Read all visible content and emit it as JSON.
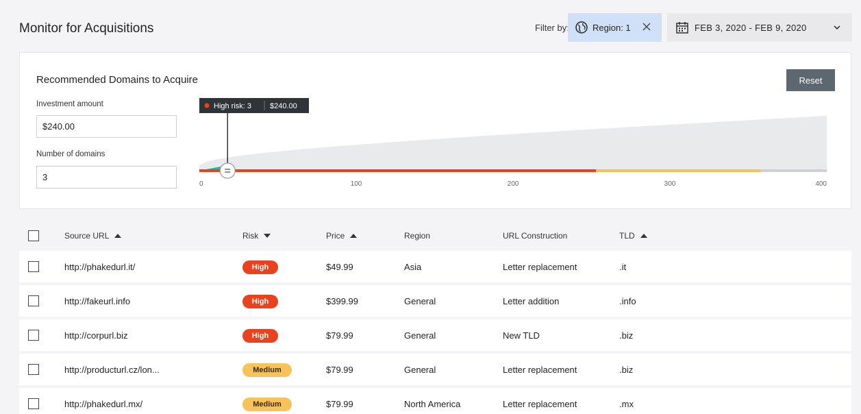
{
  "header": {
    "title": "Monitor for Acquisitions",
    "filter_label": "Filter by:",
    "region_chip": "Region: 1",
    "date_range": "FEB 3, 2020 - FEB 9, 2020"
  },
  "panel": {
    "title": "Recommended Domains to Acquire",
    "reset_label": "Reset",
    "investment_label": "Investment amount",
    "investment_value": "$240.00",
    "domains_label": "Number of domains",
    "domains_value": "3"
  },
  "chart_data": {
    "type": "area",
    "x_ticks": [
      "0",
      "100",
      "200",
      "300",
      "400"
    ],
    "xlim": [
      0,
      400
    ],
    "tooltip": {
      "label": "High risk: 3",
      "value": "$240.00"
    },
    "slider_value": 18,
    "risk_segments": [
      {
        "risk": "High",
        "from": 0,
        "to": 253,
        "color": "#e8421f"
      },
      {
        "risk": "Medium",
        "from": 253,
        "to": 358,
        "color": "#f7c25a"
      },
      {
        "risk": "Low",
        "from": 358,
        "to": 400,
        "color": "#d0d0d4"
      }
    ],
    "area_color": "#e9eaec",
    "selected_color": "#2fb3a0"
  },
  "table": {
    "columns": [
      {
        "label": "Source URL",
        "sort": "asc"
      },
      {
        "label": "Risk",
        "sort": "desc"
      },
      {
        "label": "Price",
        "sort": "asc"
      },
      {
        "label": "Region",
        "sort": ""
      },
      {
        "label": "URL Construction",
        "sort": ""
      },
      {
        "label": "TLD",
        "sort": "asc"
      }
    ],
    "rows": [
      {
        "url": "http://phakedurl.it/",
        "risk": "High",
        "price": "$49.99",
        "region": "Asia",
        "construction": "Letter replacement",
        "tld": ".it"
      },
      {
        "url": "http://fakeurl.info",
        "risk": "High",
        "price": "$399.99",
        "region": "General",
        "construction": "Letter addition",
        "tld": ".info"
      },
      {
        "url": "http://corpurl.biz",
        "risk": "High",
        "price": "$79.99",
        "region": "General",
        "construction": "New TLD",
        "tld": ".biz"
      },
      {
        "url": "http://producturl.cz/lon...",
        "risk": "Medium",
        "price": "$79.99",
        "region": "General",
        "construction": "Letter replacement",
        "tld": ".biz"
      },
      {
        "url": "http://phakedurl.mx/",
        "risk": "Medium",
        "price": "$79.99",
        "region": "North America",
        "construction": "Letter replacement",
        "tld": ".mx"
      }
    ]
  }
}
